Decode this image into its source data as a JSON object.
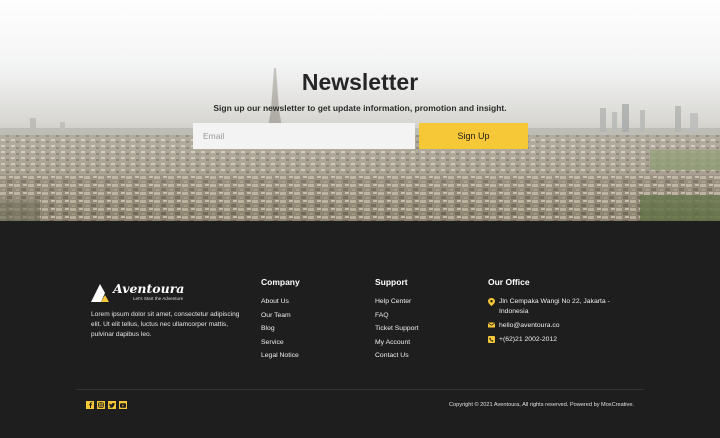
{
  "newsletter": {
    "title": "Newsletter",
    "subtitle": "Sign up our newsletter to get update information, promotion and insight.",
    "email_placeholder": "Email",
    "button_label": "Sign Up"
  },
  "footer": {
    "brand": {
      "name": "Aventoura",
      "tagline": "Let's Start the Adventure",
      "description": "Lorem ipsum dolor sit amet, consectetur adipiscing elit. Ut elit tellus, luctus nec ullamcorper mattis, pulvinar dapibus leo."
    },
    "company": {
      "title": "Company",
      "links": [
        "About Us",
        "Our Team",
        "Blog",
        "Service",
        "Legal Notice"
      ]
    },
    "support": {
      "title": "Support",
      "links": [
        "Help Center",
        "FAQ",
        "Ticket Support",
        "My Account",
        "Contact Us"
      ]
    },
    "office": {
      "title": "Our Office",
      "address": "Jln Cempaka Wangi No 22, Jakarta - Indonesia",
      "email": "hello@aventoura.co",
      "phone": "+(62)21 2002-2012"
    },
    "socials": [
      "facebook-icon",
      "instagram-icon",
      "twitter-icon",
      "youtube-icon"
    ],
    "copyright": "Copyright © 2021 Aventoura, All rights reserved. Powered by MoxCreative."
  },
  "colors": {
    "accent": "#f6c737",
    "footer_bg": "#1e1e1e",
    "input_bg": "#f3f3f3"
  }
}
